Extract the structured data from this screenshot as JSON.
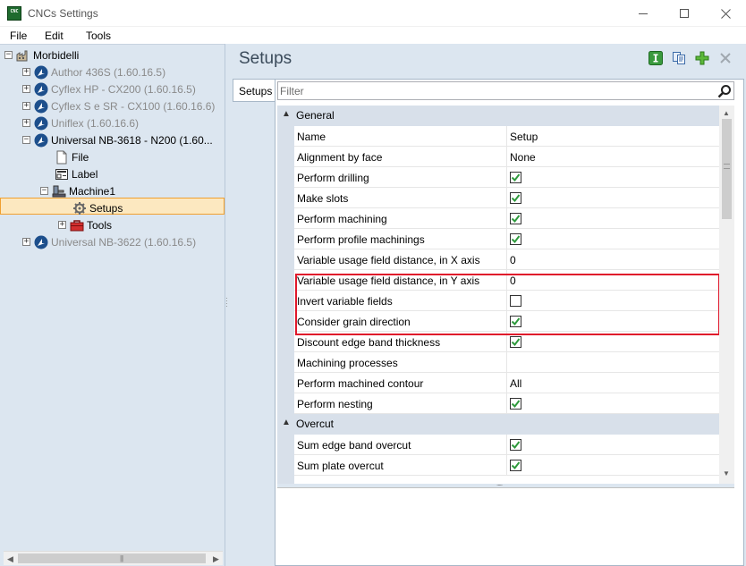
{
  "window": {
    "title": "CNCs Settings",
    "app_icon_text": "CNC"
  },
  "menu": [
    "File",
    "Edit",
    "Tools"
  ],
  "tree": {
    "root": "Morbidelli",
    "items": [
      {
        "label": "Author 436S (1.60.16.5)"
      },
      {
        "label": "Cyflex HP - CX200 (1.60.16.5)"
      },
      {
        "label": "Cyflex S e SR - CX100 (1.60.16.6)"
      },
      {
        "label": "Uniflex (1.60.16.6)"
      },
      {
        "label": "Universal NB-3618 - N200 (1.60..."
      },
      {
        "label": "File"
      },
      {
        "label": "Label"
      },
      {
        "label": "Machine1"
      },
      {
        "label": "Setups"
      },
      {
        "label": "Tools"
      },
      {
        "label": "Universal NB-3622 (1.60.16.5)"
      }
    ]
  },
  "panel": {
    "title": "Setups",
    "tab": "Setups"
  },
  "filter": {
    "placeholder": "Filter",
    "value": ""
  },
  "grid": {
    "categories": [
      {
        "label": "General"
      },
      {
        "label": "Overcut"
      }
    ],
    "rows": [
      {
        "name": "Name",
        "value": "Setup"
      },
      {
        "name": "Alignment by face",
        "value": "None"
      },
      {
        "name": "Perform drilling",
        "checked": true
      },
      {
        "name": "Make slots",
        "checked": true
      },
      {
        "name": "Perform machining",
        "checked": true
      },
      {
        "name": "Perform profile machinings",
        "checked": true
      },
      {
        "name": "Variable usage field distance, in X axis",
        "value": "0"
      },
      {
        "name": "Variable usage field distance, in Y axis",
        "value": "0"
      },
      {
        "name": "Invert variable fields",
        "checked": false
      },
      {
        "name": "Consider grain direction",
        "checked": true
      },
      {
        "name": "Discount edge band thickness",
        "checked": true
      },
      {
        "name": "Machining processes",
        "value": ""
      },
      {
        "name": "Perform machined contour",
        "value": "All"
      },
      {
        "name": "Perform nesting",
        "checked": true
      },
      {
        "name": "Sum edge band overcut",
        "checked": true
      },
      {
        "name": "Sum plate overcut",
        "checked": true
      }
    ]
  },
  "colors": {
    "highlight": "#e0182b",
    "selection_bg": "#fce8c0",
    "check": "#2e9a3c",
    "pane_bg": "#dce6f0"
  }
}
